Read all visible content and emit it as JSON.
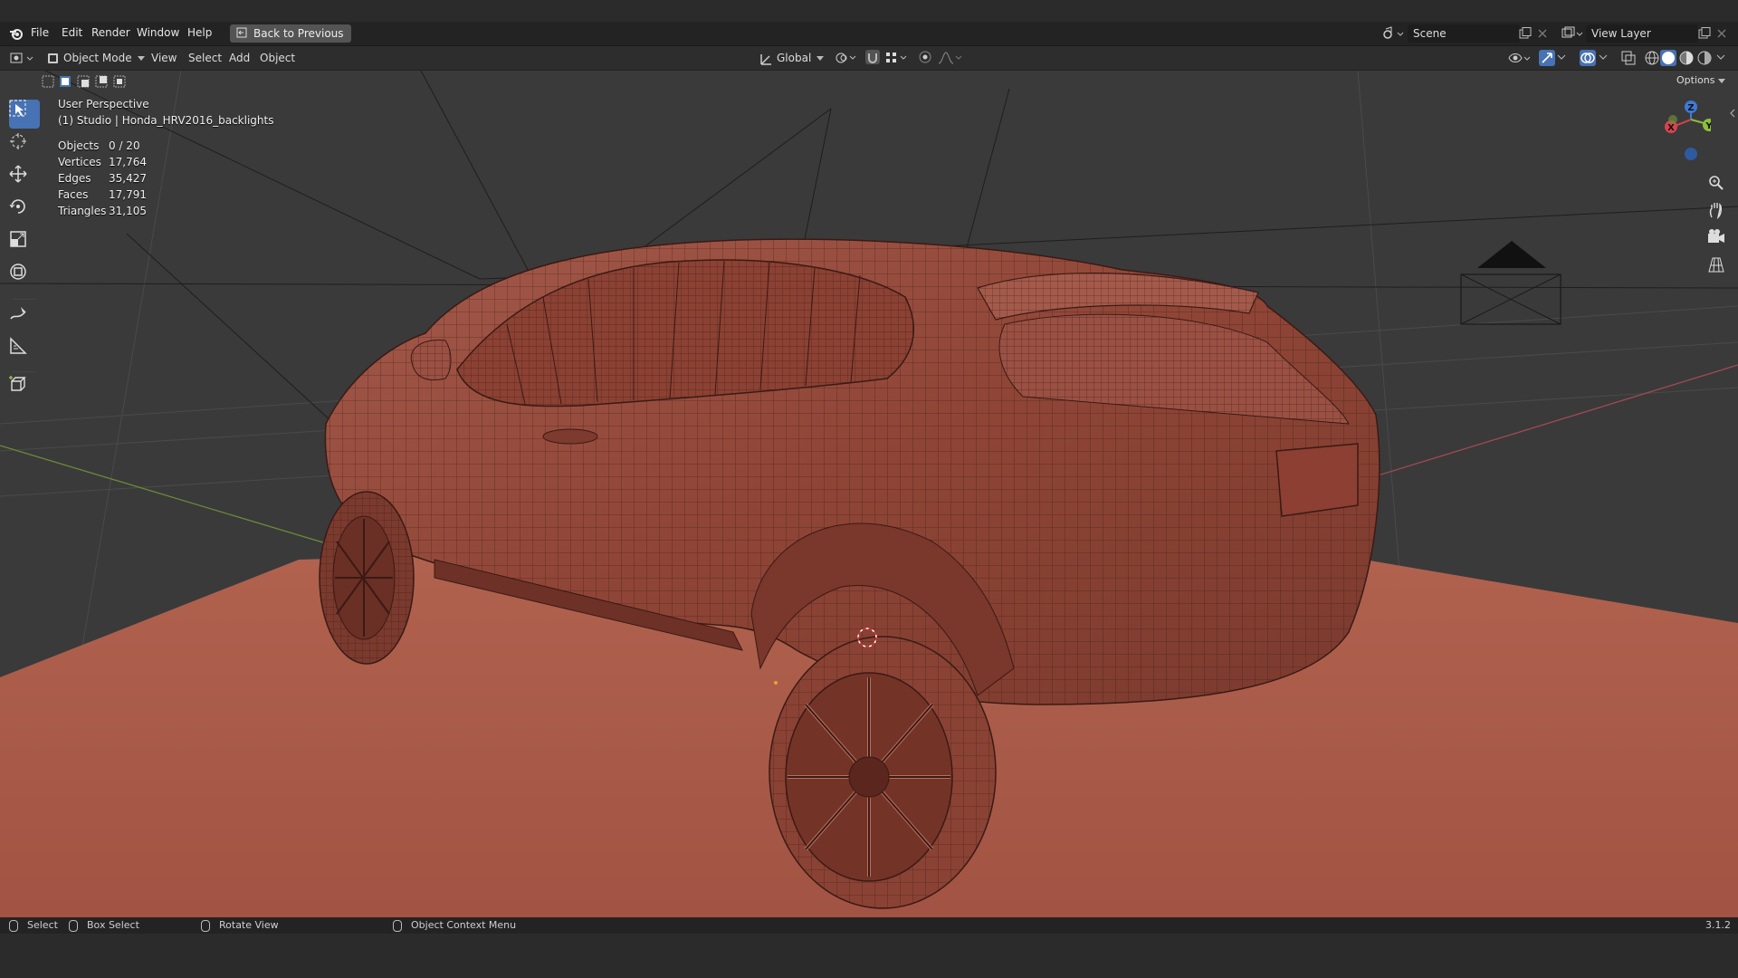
{
  "app": {
    "logo": "blender-icon",
    "version": "3.1.2"
  },
  "menubar": {
    "items": [
      "File",
      "Edit",
      "Render",
      "Window",
      "Help"
    ],
    "back_button": "Back to Previous",
    "scene_name": "Scene",
    "view_layer_name": "View Layer"
  },
  "header": {
    "mode": "Object Mode",
    "menus": [
      "View",
      "Select",
      "Add",
      "Object"
    ],
    "transform_orientation": "Global",
    "options_label": "Options"
  },
  "viewport": {
    "view_name": "User Perspective",
    "object_label": "(1) Studio | Honda_HRV2016_backlights",
    "stats": [
      {
        "label": "Objects",
        "value": "0 / 20"
      },
      {
        "label": "Vertices",
        "value": "17,764"
      },
      {
        "label": "Edges",
        "value": "35,427"
      },
      {
        "label": "Faces",
        "value": "17,791"
      },
      {
        "label": "Triangles",
        "value": "31,105"
      }
    ],
    "gizmo_axes": {
      "x": "X",
      "y": "Y",
      "z": "Z"
    },
    "colors": {
      "x_axis": "#d9434f",
      "y_axis": "#8cbf3a",
      "z_axis": "#3f7ad4",
      "floor": "#a85d4c",
      "car": "#9a4b3e"
    }
  },
  "toolbar": {
    "tools": [
      "select-box-tool",
      "cursor-tool",
      "move-tool",
      "rotate-tool",
      "scale-tool",
      "transform-tool",
      "annotate-tool",
      "measure-tool",
      "add-cube-tool"
    ]
  },
  "statusbar": {
    "select": "Select",
    "box_select": "Box Select",
    "rotate_view": "Rotate View",
    "context_menu": "Object Context Menu"
  }
}
